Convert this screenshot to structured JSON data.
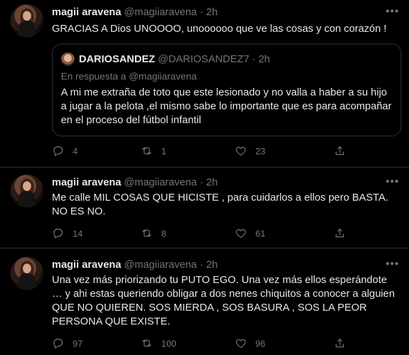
{
  "tweets": [
    {
      "name": "magii aravena",
      "handle": "@magiiaravena",
      "time": "2h",
      "text": "GRACIAS A Dios UNOOOO, unoooooo que ve las cosas y con corazón !",
      "quote": {
        "name": "DARIOSANDEZ",
        "handle": "@DARIOSANDEZ7",
        "time": "2h",
        "reply_to": "En respuesta a @magiiaravena",
        "text": "A mi me extraña de toto que este lesionado y no valla a haber a su hijo a jugar a la pelota ,el mismo sabe lo importante que es para acompañar en el proceso del fútbol infantil"
      },
      "replies": "4",
      "retweets": "1",
      "likes": "23"
    },
    {
      "name": "magii aravena",
      "handle": "@magiiaravena",
      "time": "2h",
      "text": "Me calle MIL COSAS QUE HICISTE , para cuidarlos a ellos pero BASTA. NO ES NO.",
      "replies": "14",
      "retweets": "8",
      "likes": "61"
    },
    {
      "name": "magii aravena",
      "handle": "@magiiaravena",
      "time": "2h",
      "text": "Una vez más priorizando tu PUTO EGO. Una vez más ellos esperándote  … y ahi estas queriendo obligar a dos nenes chiquitos a conocer a alguien QUE NO QUIEREN. SOS MIERDA , SOS BASURA , SOS LA  PEOR PERSONA QUE EXISTE.",
      "replies": "97",
      "retweets": "100",
      "likes": "96"
    }
  ],
  "icons": {
    "more": "more-icon",
    "reply": "reply-icon",
    "retweet": "retweet-icon",
    "like": "heart-icon",
    "share": "share-icon"
  },
  "separator": "·",
  "colors": {
    "background": "#000000",
    "text": "#e7e9ea",
    "muted": "#71767b",
    "border": "#2f3336"
  }
}
